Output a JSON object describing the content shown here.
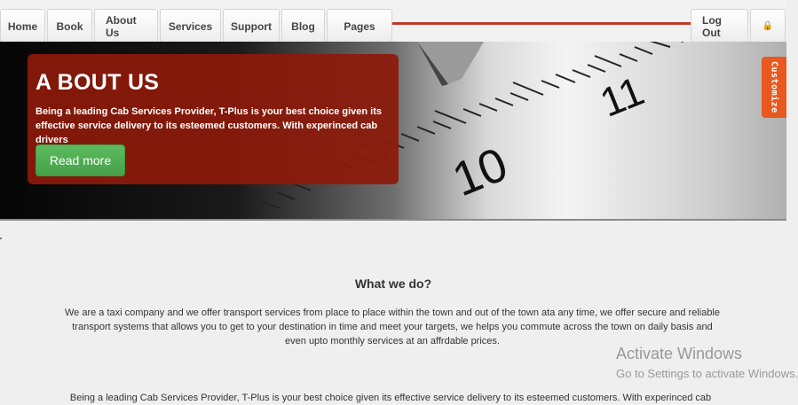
{
  "nav": {
    "items": [
      {
        "label": "Home"
      },
      {
        "label": "Book"
      },
      {
        "label": "About Us"
      },
      {
        "label": "Services"
      },
      {
        "label": "Support"
      },
      {
        "label": "Blog"
      },
      {
        "label": "Pages"
      }
    ],
    "logout_label": "Log Out",
    "lock_icon": "lock-icon"
  },
  "hero": {
    "ruler_numbers": [
      "10",
      "11"
    ],
    "about": {
      "title": "A BOUT US",
      "text": "Being a leading Cab Services Provider, T-Plus is your best choice given its effective service delivery to its esteemed customers. With experinced cab drivers",
      "button_label": "Read more"
    }
  },
  "customize": {
    "label": "Customize"
  },
  "section": {
    "title": "What we do?",
    "text": "We are a taxi company and we offer transport services from place to place within the town and out of the town ata any time, we offer secure and reliable transport systems that allows you to get to your destination in time and meet your targets, we helps you commute across the town on daily basis and even upto monthly services at an affrdable prices.",
    "text2": "Being a leading Cab Services Provider, T-Plus is your best choice given its effective service delivery to its esteemed customers. With experinced cab"
  },
  "watermark": {
    "line1": "Activate Windows",
    "line2": "Go to Settings to activate Windows."
  },
  "colors": {
    "accent_red": "#c0392b",
    "card_red": "#8c1a0a",
    "button_green": "#4cae4c",
    "customize_orange": "#e8591f"
  }
}
